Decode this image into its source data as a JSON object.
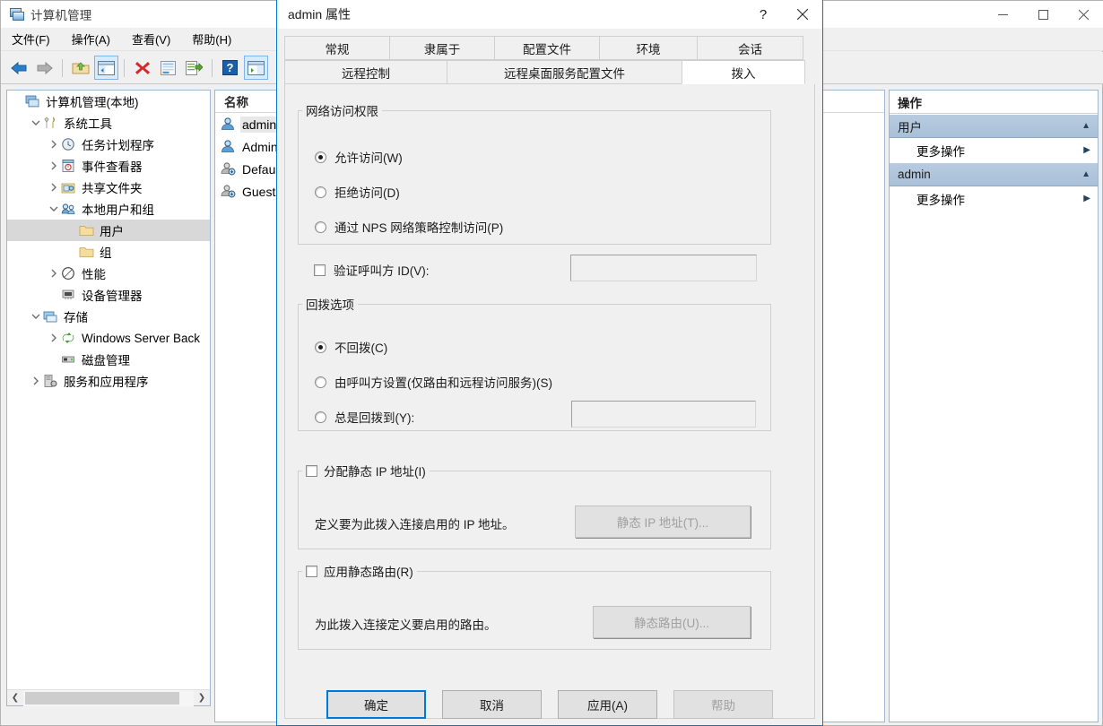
{
  "mmc": {
    "title": "计算机管理",
    "title_icon": "computer-management-icon",
    "menus": [
      {
        "label": "文件(F)"
      },
      {
        "label": "操作(A)"
      },
      {
        "label": "查看(V)"
      },
      {
        "label": "帮助(H)"
      }
    ],
    "toolbar": [
      {
        "name": "back-icon",
        "glyph": "arrow-left-blue"
      },
      {
        "name": "forward-icon",
        "glyph": "arrow-right-gray"
      },
      {
        "name": "up-one-level-icon",
        "glyph": "folder-up"
      },
      {
        "name": "show-hide-tree-icon",
        "glyph": "tree-pane",
        "pressed": true
      },
      {
        "name": "delete-icon",
        "glyph": "red-x"
      },
      {
        "name": "properties-icon",
        "glyph": "properties"
      },
      {
        "name": "export-list-icon",
        "glyph": "export"
      },
      {
        "name": "help-icon",
        "glyph": "question-blue"
      },
      {
        "name": "show-hide-actions-icon",
        "glyph": "action-pane",
        "pressed": true
      }
    ],
    "tree": [
      {
        "label": "计算机管理(本地)",
        "indent": 0,
        "twisty": "none",
        "icon": "computer-icon"
      },
      {
        "label": "系统工具",
        "indent": 1,
        "twisty": "expanded",
        "icon": "tools-icon"
      },
      {
        "label": "任务计划程序",
        "indent": 2,
        "twisty": "collapsed",
        "icon": "clock-icon"
      },
      {
        "label": "事件查看器",
        "indent": 2,
        "twisty": "collapsed",
        "icon": "event-viewer-icon"
      },
      {
        "label": "共享文件夹",
        "indent": 2,
        "twisty": "collapsed",
        "icon": "shared-folders-icon"
      },
      {
        "label": "本地用户和组",
        "indent": 2,
        "twisty": "expanded",
        "icon": "users-groups-icon"
      },
      {
        "label": "用户",
        "indent": 3,
        "twisty": "none",
        "icon": "folder-icon",
        "selected": true
      },
      {
        "label": "组",
        "indent": 3,
        "twisty": "none",
        "icon": "folder-icon"
      },
      {
        "label": "性能",
        "indent": 2,
        "twisty": "collapsed",
        "icon": "performance-icon"
      },
      {
        "label": "设备管理器",
        "indent": 2,
        "twisty": "none",
        "icon": "device-manager-icon"
      },
      {
        "label": "存储",
        "indent": 1,
        "twisty": "expanded",
        "icon": "storage-icon"
      },
      {
        "label": "Windows Server Back",
        "indent": 2,
        "twisty": "collapsed",
        "icon": "backup-icon"
      },
      {
        "label": "磁盘管理",
        "indent": 2,
        "twisty": "none",
        "icon": "disk-management-icon"
      },
      {
        "label": "服务和应用程序",
        "indent": 1,
        "twisty": "collapsed",
        "icon": "services-icon"
      }
    ],
    "list": {
      "columns": [
        "名称"
      ],
      "rows": [
        {
          "name": "admin",
          "icon": "user-icon",
          "selected": true
        },
        {
          "name": "Administrator",
          "icon": "user-icon"
        },
        {
          "name": "DefaultAccount",
          "icon": "user-disabled-icon"
        },
        {
          "name": "Guest",
          "icon": "user-disabled-icon"
        }
      ]
    },
    "actions": {
      "title": "操作",
      "groups": [
        {
          "header": "用户",
          "items": [
            {
              "label": "更多操作"
            }
          ]
        },
        {
          "header": "admin",
          "items": [
            {
              "label": "更多操作"
            }
          ]
        }
      ]
    }
  },
  "dialog": {
    "title": "admin 属性",
    "help_button": "?",
    "close_button": "✕",
    "tabs_row1": [
      {
        "label": "常规"
      },
      {
        "label": "隶属于"
      },
      {
        "label": "配置文件"
      },
      {
        "label": "环境"
      },
      {
        "label": "会话"
      }
    ],
    "tabs_row2": [
      {
        "label": "远程控制"
      },
      {
        "label": "远程桌面服务配置文件"
      },
      {
        "label": "拨入",
        "active": true
      }
    ],
    "network_access": {
      "legend": "网络访问权限",
      "options": [
        {
          "label": "允许访问(W)",
          "checked": true
        },
        {
          "label": "拒绝访问(D)",
          "checked": false
        },
        {
          "label": "通过 NPS 网络策略控制访问(P)",
          "checked": false
        }
      ]
    },
    "verify_caller_id": {
      "label": "验证呼叫方 ID(V):",
      "checked": false,
      "value": ""
    },
    "callback": {
      "legend": "回拨选项",
      "options": [
        {
          "label": "不回拨(C)",
          "checked": true
        },
        {
          "label": "由呼叫方设置(仅路由和远程访问服务)(S)",
          "checked": false
        },
        {
          "label": "总是回拨到(Y):",
          "checked": false
        }
      ],
      "callback_to_value": ""
    },
    "static_ip": {
      "legend": "分配静态 IP 地址(I)",
      "checked": false,
      "description": "定义要为此拨入连接启用的 IP 地址。",
      "button": "静态 IP 地址(T)...",
      "button_disabled": true
    },
    "static_routes": {
      "legend": "应用静态路由(R)",
      "checked": false,
      "description": "为此拨入连接定义要启用的路由。",
      "button": "静态路由(U)...",
      "button_disabled": true
    },
    "buttons": [
      {
        "label": "确定",
        "default": true,
        "disabled": false
      },
      {
        "label": "取消",
        "default": false,
        "disabled": false
      },
      {
        "label": "应用(A)",
        "default": false,
        "disabled": false
      },
      {
        "label": "帮助",
        "default": false,
        "disabled": true
      }
    ]
  },
  "colors": {
    "accent": "#0078d7",
    "dialog_bg": "#f0f0f0",
    "selection": "#d8d8d8",
    "action_header": "#a9c0d8"
  }
}
